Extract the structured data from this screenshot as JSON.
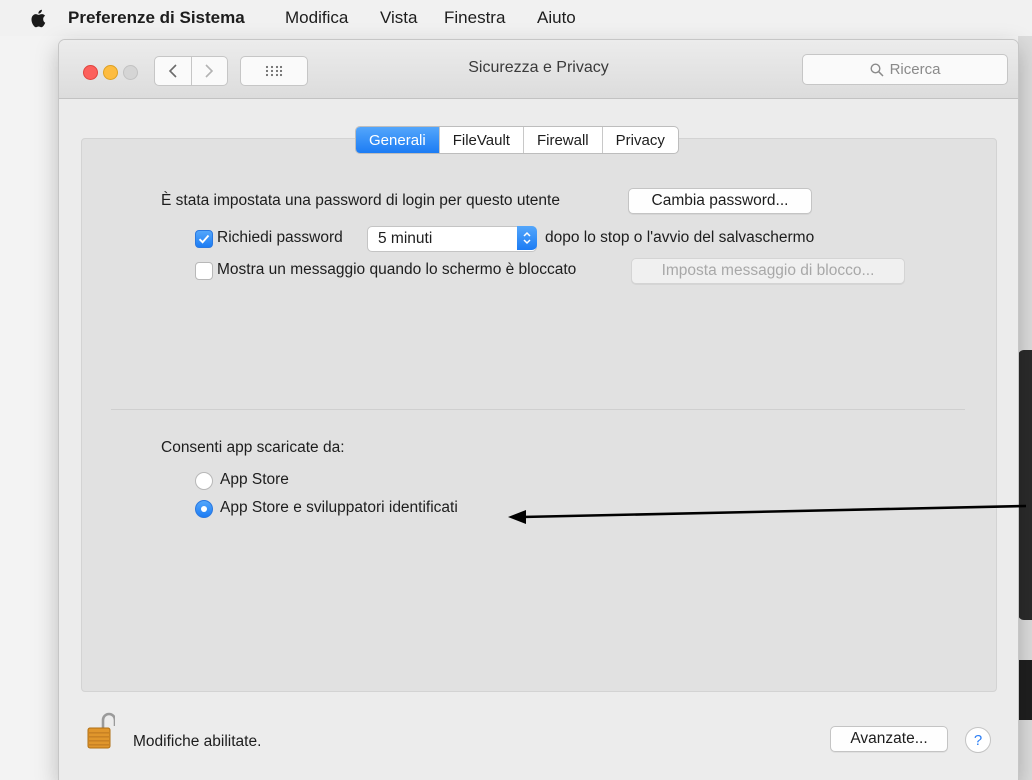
{
  "menubar": {
    "app_name": "Preferenze di Sistema",
    "items": [
      "Modifica",
      "Vista",
      "Finestra",
      "Aiuto"
    ]
  },
  "window": {
    "title": "Sicurezza e Privacy",
    "search_placeholder": "Ricerca"
  },
  "tabs": [
    {
      "label": "Generali",
      "active": true
    },
    {
      "label": "FileVault",
      "active": false
    },
    {
      "label": "Firewall",
      "active": false
    },
    {
      "label": "Privacy",
      "active": false
    }
  ],
  "general": {
    "password_text": "È stata impostata una password di login per questo utente",
    "change_password_button": "Cambia password...",
    "require_password_label": "Richiedi password",
    "require_password_checked": true,
    "require_password_delay": "5 minuti",
    "require_password_suffix": "dopo lo stop o l'avvio del salvaschermo",
    "show_message_label": "Mostra un messaggio quando lo schermo è bloccato",
    "show_message_checked": false,
    "set_lock_message_button": "Imposta messaggio di blocco..."
  },
  "allow_apps": {
    "label": "Consenti app scaricate da:",
    "options": [
      {
        "label": "App Store",
        "selected": false
      },
      {
        "label": "App Store e sviluppatori identificati",
        "selected": true
      }
    ]
  },
  "footer": {
    "lock_status": "Modifiche abilitate.",
    "advanced_button": "Avanzate...",
    "help_button": "?"
  },
  "colors": {
    "accent": "#1c7cf4",
    "lock": "#e0962c"
  }
}
